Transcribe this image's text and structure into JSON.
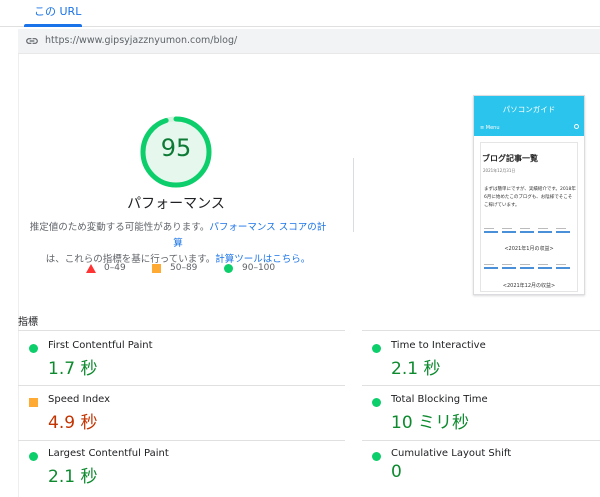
{
  "tab": {
    "label": "この URL"
  },
  "url": {
    "text": "https://www.gipsyjazznyumon.com/blog/"
  },
  "score": {
    "value": "95",
    "fraction": 0.95,
    "label": "パフォーマンス",
    "color": "#0cce6b"
  },
  "note": {
    "text1": "推定値のため変動する可能性があります。",
    "link1": "パフォーマンス スコアの計算",
    "text2": "は、これらの指標を基に行っています。",
    "link2": "計算ツールはこちら。"
  },
  "legend": [
    {
      "shape": "triangle",
      "label": "0–49",
      "color": "#ff3333"
    },
    {
      "shape": "square",
      "label": "50–89",
      "color": "#ffaa33"
    },
    {
      "shape": "circle",
      "label": "90–100",
      "color": "#0cce6b"
    }
  ],
  "thumbnail": {
    "site_title": "パソコンガイド",
    "menu": "≡ Menu",
    "heading": "ブログ記事一覧",
    "date": "2021年12月31日",
    "body": "まずは簡単にですが、実績紹介です。2018年6月に始めたこのブログも、お陰様でそこそこ稼げています。",
    "sub1": "<2021年1月の収益>",
    "sub2": "<2021年12月の収益>"
  },
  "metrics_label": "指標",
  "metrics": [
    {
      "name": "First Contentful Paint",
      "value": "1.7 秒",
      "status": "good"
    },
    {
      "name": "Time to Interactive",
      "value": "2.1 秒",
      "status": "good"
    },
    {
      "name": "Speed Index",
      "value": "4.9 秒",
      "status": "average"
    },
    {
      "name": "Total Blocking Time",
      "value": "10 ミリ秒",
      "status": "good"
    },
    {
      "name": "Largest Contentful Paint",
      "value": "2.1 秒",
      "status": "good"
    },
    {
      "name": "Cumulative Layout Shift",
      "value": "0",
      "status": "good"
    }
  ],
  "colors": {
    "accent": "#1a73e8",
    "good": "#0cce6b",
    "good_text": "#0d8a2e",
    "average": "#ffaa33",
    "average_text": "#c33300",
    "poor": "#ff3333"
  }
}
